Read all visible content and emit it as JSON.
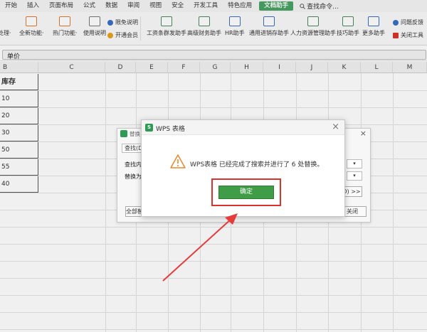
{
  "menubar": {
    "items": [
      "开始",
      "插入",
      "页面布局",
      "公式",
      "数据",
      "审阅",
      "视图",
      "安全",
      "开发工具",
      "特色应用",
      "文档助手"
    ],
    "active": "文档助手",
    "search_label": "查找命令..."
  },
  "ribbon": {
    "buttons": [
      {
        "label": "处理·",
        "name": "process-button"
      },
      {
        "label": "全新功能·",
        "name": "new-features-button"
      },
      {
        "label": "热门功能·",
        "name": "hot-features-button"
      },
      {
        "label": "使用说明",
        "name": "instructions-button"
      },
      {
        "label": "限免说明",
        "name": "free-limit-button"
      },
      {
        "label": "开通会员",
        "name": "membership-button"
      },
      {
        "label": "工资条群发助手",
        "name": "payslip-button"
      },
      {
        "label": "高级财务助手",
        "name": "finance-button"
      },
      {
        "label": "HR助手",
        "name": "hr-button"
      },
      {
        "label": "通用进销存助手",
        "name": "inventory-button"
      },
      {
        "label": "人力资源管理助手",
        "name": "hr-manage-button"
      },
      {
        "label": "技巧助手",
        "name": "tips-button"
      },
      {
        "label": "更多助手",
        "name": "more-button"
      },
      {
        "label": "问题反馈",
        "name": "feedback-button"
      },
      {
        "label": "关闭工具",
        "name": "close-tool-button"
      }
    ]
  },
  "formula_bar": {
    "cell_value": "单价"
  },
  "sheet": {
    "columns": [
      "B",
      "C",
      "D",
      "E",
      "F",
      "G",
      "H",
      "I",
      "J",
      "K",
      "L",
      "M"
    ],
    "header": "库存",
    "values": [
      "10",
      "20",
      "30",
      "50",
      "55",
      "40"
    ]
  },
  "replace_dialog": {
    "title": "替换",
    "tab": "查找(D)",
    "find_label": "查找内",
    "replace_label": "替换为",
    "options_button": "D) >>",
    "replace_all_button": "全部替",
    "close_button": "关闭"
  },
  "message_dialog": {
    "title": "WPS 表格",
    "logo": "S",
    "message": "WPS表格 已经完成了搜索并进行了 6 处替换。",
    "ok_button": "确定"
  },
  "colors": {
    "accent": "#4aa364",
    "highlight": "#d9342b",
    "ok": "#3f9c47"
  }
}
